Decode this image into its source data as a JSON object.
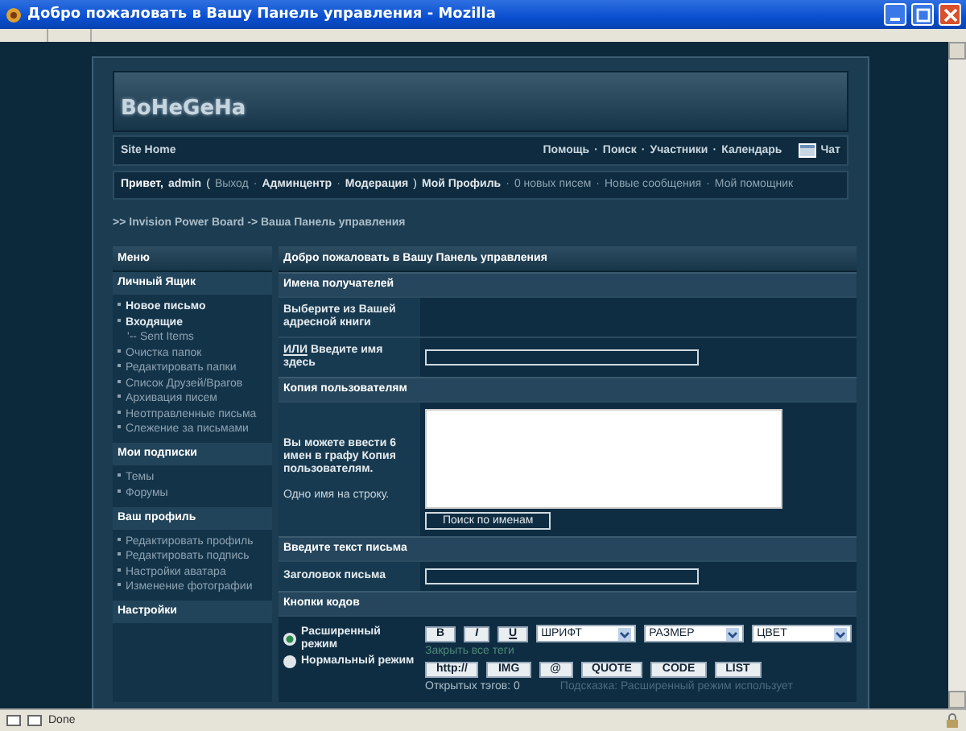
{
  "window": {
    "title": "Добро пожаловать в Вашу Панель управления - Mozilla",
    "status": "Done"
  },
  "banner": {
    "logo": "BoHeGeHa"
  },
  "nav": {
    "home": "Site Home",
    "links": [
      "Помощь",
      "Поиск",
      "Участники",
      "Календарь"
    ],
    "separator": "·",
    "chat": "Чат"
  },
  "user_bar": [
    {
      "text": "Привет,",
      "kind": "strong"
    },
    {
      "text": "admin",
      "kind": "link"
    },
    {
      "text": "(",
      "kind": "punct"
    },
    {
      "text": "Выход",
      "kind": "muted"
    },
    {
      "text": "·",
      "kind": "muted"
    },
    {
      "text": "Админцентр",
      "kind": "link"
    },
    {
      "text": "·",
      "kind": "muted"
    },
    {
      "text": "Модерация",
      "kind": "link"
    },
    {
      "text": ")",
      "kind": "punct"
    },
    {
      "text": "Мой Профиль",
      "kind": "link"
    },
    {
      "text": "·",
      "kind": "muted"
    },
    {
      "text": "0 новых писем",
      "kind": "muted"
    },
    {
      "text": "·",
      "kind": "muted"
    },
    {
      "text": "Новые сообщения",
      "kind": "muted"
    },
    {
      "text": "·",
      "kind": "muted"
    },
    {
      "text": "Мой помощник",
      "kind": "muted"
    }
  ],
  "breadcrumb": ">> Invision Power Board -> Ваша Панель управления",
  "sidebar": {
    "title": "Меню",
    "sections": [
      {
        "title": "Личный Ящик",
        "items": [
          {
            "label": "Новое письмо",
            "kind": "primary"
          },
          {
            "label": "Входящие",
            "kind": "primary"
          },
          {
            "label": "'-- Sent Items",
            "kind": "sub"
          },
          {
            "label": "Очистка папок",
            "kind": "item"
          },
          {
            "label": "Редактировать папки",
            "kind": "item"
          },
          {
            "label": "Список Друзей/Врагов",
            "kind": "item"
          },
          {
            "label": "Архивация писем",
            "kind": "item"
          },
          {
            "label": "Неотправленные письма",
            "kind": "item"
          },
          {
            "label": "Слежение за письмами",
            "kind": "item"
          }
        ]
      },
      {
        "title": "Мои подписки",
        "items": [
          {
            "label": "Темы",
            "kind": "item"
          },
          {
            "label": "Форумы",
            "kind": "item"
          }
        ]
      },
      {
        "title": "Ваш профиль",
        "items": [
          {
            "label": "Редактировать профиль",
            "kind": "item"
          },
          {
            "label": "Редактировать подпись",
            "kind": "item"
          },
          {
            "label": "Настройки аватара",
            "kind": "item"
          },
          {
            "label": "Изменение фотографии",
            "kind": "item"
          }
        ]
      },
      {
        "title": "Настройки"
      }
    ]
  },
  "main": {
    "title": "Добро пожаловать в Вашу Панель управления",
    "rows": [
      {
        "kind": "header",
        "label": "Имена получателей"
      },
      {
        "kind": "plain",
        "label": "Выберите из Вашей адресной книги"
      },
      {
        "kind": "field",
        "prefix": "ИЛИ",
        "label": "Введите имя здесь"
      },
      {
        "kind": "header",
        "label": "Копия пользователям"
      },
      {
        "kind": "textarea",
        "label": "Вы можете ввести 6 имен в графу Копия пользователям.",
        "note": "Одно имя на строку.",
        "button": "Поиск по именам"
      },
      {
        "kind": "header",
        "label": "Введите текст письма"
      },
      {
        "kind": "field",
        "label": "Заголовок письма"
      },
      {
        "kind": "header",
        "label": "Кнопки кодов"
      }
    ],
    "editor": {
      "modes": [
        {
          "label": "Расширенный режим",
          "selected": true
        },
        {
          "label": "Нормальный режим",
          "selected": false
        }
      ],
      "format_buttons": [
        "B",
        "I",
        "U"
      ],
      "selects": [
        "ШРИФТ",
        "РАЗМЕР",
        "ЦВЕТ"
      ],
      "close_tags": "Закрыть все теги",
      "tag_buttons": [
        "http://",
        "IMG",
        "@",
        "QUOTE",
        "CODE",
        "LIST"
      ],
      "open_tags": "Открытых тэгов: 0",
      "hint": "Подсказка: Расширенный режим использует"
    }
  }
}
